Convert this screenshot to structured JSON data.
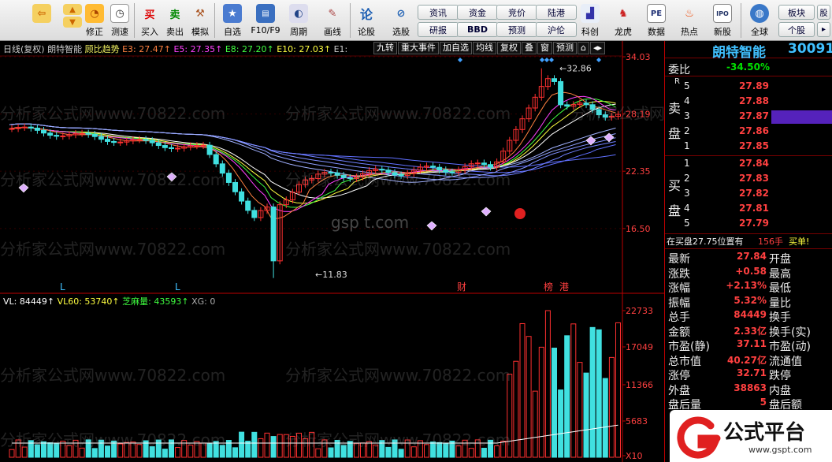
{
  "toolbar": {
    "buttons": [
      {
        "label": "修正",
        "icon": "arrow-left-icon"
      },
      {
        "label": "测速",
        "icon": "speedometer-icon"
      },
      {
        "label": "买入",
        "icon": "buy-icon",
        "glyph": "买"
      },
      {
        "label": "卖出",
        "icon": "sell-icon",
        "glyph": "卖"
      },
      {
        "label": "模拟",
        "icon": "hammer-icon"
      },
      {
        "label": "自选",
        "icon": "star-icon"
      },
      {
        "label": "F10/F9",
        "icon": "f10-icon"
      },
      {
        "label": "周期",
        "icon": "clock-icon"
      },
      {
        "label": "画线",
        "icon": "pencil-icon"
      },
      {
        "label": "论股",
        "icon": "discuss-icon",
        "glyph": "论"
      },
      {
        "label": "选股",
        "icon": "stock-pick-icon"
      },
      {
        "label": "科创",
        "icon": "chart-icon"
      },
      {
        "label": "龙虎",
        "icon": "dragon-icon"
      },
      {
        "label": "数据",
        "icon": "data-icon",
        "glyph": "PE"
      },
      {
        "label": "热点",
        "icon": "fire-icon"
      },
      {
        "label": "新股",
        "icon": "ipo-icon",
        "glyph": "IPO"
      },
      {
        "label": "全球",
        "icon": "globe-icon"
      }
    ],
    "pills": [
      "资讯",
      "资金",
      "竞价",
      "陆港",
      "研报",
      "BBD",
      "预测",
      "沪伦",
      "板块",
      "个股"
    ]
  },
  "chart": {
    "info_name": "日线(复权)",
    "stock": "朗特智能",
    "indicator": "顾比趋势",
    "e3": "E3: 27.47",
    "e5": "E5: 27.35",
    "e8": "E8: 27.20",
    "e10": "E10: 27.03",
    "e1": "E1:",
    "tabs": [
      "九转",
      "重大事件",
      "加自选",
      "均线",
      "复权",
      "叠",
      "窗",
      "预测"
    ],
    "price_axis": [
      "34.03",
      "28.19",
      "22.35",
      "16.50"
    ],
    "high_label": "32.86",
    "low_label": "11.83",
    "markers": [
      "L",
      "L",
      "财",
      "榜",
      "港"
    ],
    "watermark": "gsp t.com",
    "vol_info": {
      "vl": "VL: 84449",
      "vl60": "VL60: 53740",
      "zmvol": "芝麻量: 43593",
      "xg": "XG: 0"
    },
    "vol_axis": [
      "22733",
      "17049",
      "11366",
      "5683",
      "X10"
    ],
    "bg_watermark": "分析家公式网www.70822.com"
  },
  "side": {
    "title": "朗特智能",
    "code": "30091",
    "weibi_label": "委比",
    "weibi_value": "-34.50%",
    "r_label": "R",
    "sell_label": [
      "卖",
      "盘"
    ],
    "buy_label": [
      "买",
      "盘"
    ],
    "asks": [
      {
        "lvl": "5",
        "price": "27.89"
      },
      {
        "lvl": "4",
        "price": "27.88"
      },
      {
        "lvl": "3",
        "price": "27.87"
      },
      {
        "lvl": "2",
        "price": "27.86"
      },
      {
        "lvl": "1",
        "price": "27.85"
      }
    ],
    "bids": [
      {
        "lvl": "1",
        "price": "27.84"
      },
      {
        "lvl": "2",
        "price": "27.83"
      },
      {
        "lvl": "3",
        "price": "27.82"
      },
      {
        "lvl": "4",
        "price": "27.81"
      },
      {
        "lvl": "5",
        "price": "27.79"
      }
    ],
    "notice": "在买盘27.75位置有",
    "notice_qty": "156手",
    "notice_tail": "买单!",
    "stats": [
      {
        "k": "最新",
        "v": "27.84",
        "k2": "开盘"
      },
      {
        "k": "涨跌",
        "v": "+0.58",
        "k2": "最高"
      },
      {
        "k": "涨幅",
        "v": "+2.13%",
        "k2": "最低"
      },
      {
        "k": "振幅",
        "v": "5.32%",
        "k2": "量比"
      },
      {
        "k": "总手",
        "v": "84449",
        "k2": "换手"
      },
      {
        "k": "金额",
        "v": "2.33亿",
        "k2": "换手(实)"
      },
      {
        "k": "市盈(静)",
        "v": "37.11",
        "k2": "市盈(动)"
      },
      {
        "k": "总市值",
        "v": "40.27亿",
        "k2": "流通值"
      },
      {
        "k": "涨停",
        "v": "32.71",
        "k2": "跌停"
      },
      {
        "k": "外盘",
        "v": "38863",
        "k2": "内盘"
      },
      {
        "k": "盘后量",
        "v": "5",
        "k2": "盘后额"
      }
    ]
  },
  "logo": {
    "text": "公式平台",
    "url": "www.gspt.com"
  }
}
